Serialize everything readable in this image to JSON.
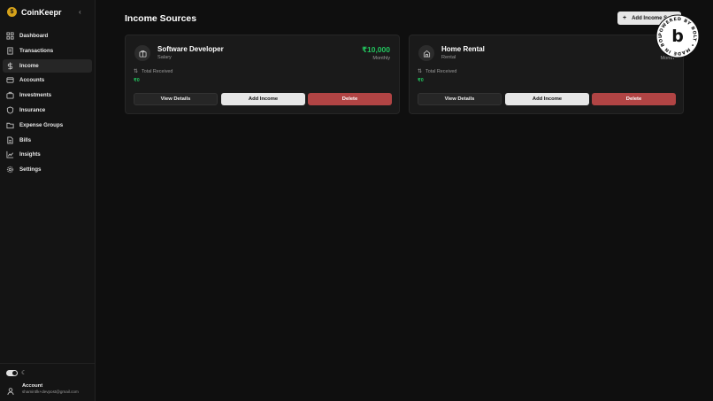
{
  "app": {
    "name": "CoinKeepr",
    "logo_glyph": "$",
    "collapse_glyph": "‹"
  },
  "sidebar": {
    "items": [
      {
        "label": "Dashboard",
        "icon": "dashboard-icon",
        "active": false
      },
      {
        "label": "Transactions",
        "icon": "receipt-icon",
        "active": false
      },
      {
        "label": "Income",
        "icon": "dollar-icon",
        "active": true
      },
      {
        "label": "Accounts",
        "icon": "credit-card-icon",
        "active": false
      },
      {
        "label": "Investments",
        "icon": "briefcase-icon",
        "active": false
      },
      {
        "label": "Insurance",
        "icon": "shield-icon",
        "active": false
      },
      {
        "label": "Expense Groups",
        "icon": "folder-icon",
        "active": false
      },
      {
        "label": "Bills",
        "icon": "file-icon",
        "active": false
      },
      {
        "label": "Insights",
        "icon": "chart-icon",
        "active": false
      },
      {
        "label": "Settings",
        "icon": "gear-icon",
        "active": false
      }
    ],
    "account": {
      "label": "Account",
      "email": "shamintlk+devpost@gmail.com"
    }
  },
  "main": {
    "title": "Income Sources",
    "add_button": "Add Income S",
    "cards": [
      {
        "title": "Software Developer",
        "type": "Salary",
        "amount": "₹10,000",
        "frequency": "Monthly",
        "total_label": "Total Received",
        "total_value": "₹0",
        "view_label": "View Details",
        "add_label": "Add Income",
        "delete_label": "Delete"
      },
      {
        "title": "Home Rental",
        "type": "Rental",
        "amount": "₹",
        "frequency": "Month",
        "total_label": "Total Received",
        "total_value": "₹0",
        "view_label": "View Details",
        "add_label": "Add Income",
        "delete_label": "Delete"
      }
    ]
  },
  "badge": {
    "text": "POWERED BY BOLT • MADE IN BOLT • ",
    "glyph": "b"
  },
  "colors": {
    "accent_green": "#22c55e",
    "delete_red": "#b14444",
    "brand_gold": "#d6a21a"
  }
}
